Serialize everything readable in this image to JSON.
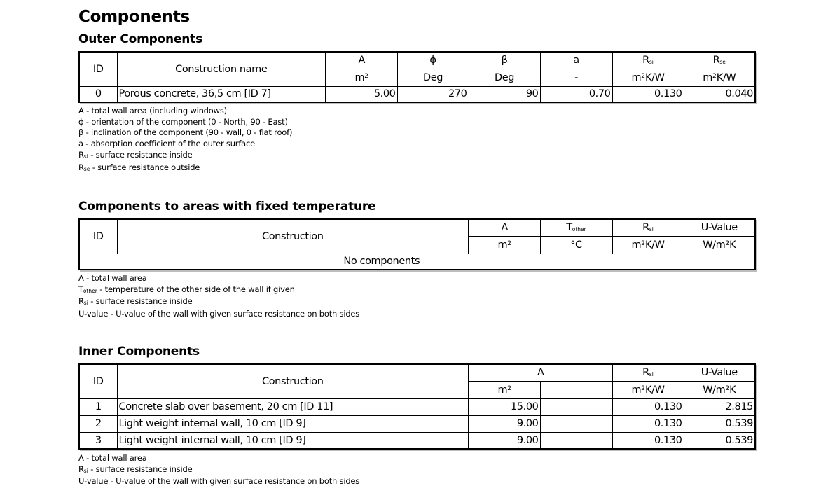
{
  "title": "Components",
  "outer": {
    "heading": "Outer Components",
    "headers": {
      "id": "ID",
      "name": "Construction name",
      "a_sym": "A",
      "a_unit_base": "m",
      "a_unit_sup": "2",
      "phi_sym": "ϕ",
      "phi_unit": "Deg",
      "beta_sym": "β",
      "beta_unit": "Deg",
      "abs_sym": "a",
      "abs_unit": "-",
      "rsi_base": "R",
      "rsi_sub": "si",
      "rsi_unit_pre": "m",
      "rsi_unit_sup": "2",
      "rsi_unit_post": "K/W",
      "rse_base": "R",
      "rse_sub": "se",
      "rse_unit_pre": "m",
      "rse_unit_sup": "2",
      "rse_unit_post": "K/W"
    },
    "rows": [
      {
        "id": "0",
        "name": "Porous concrete, 36,5 cm [ID 7]",
        "a": "5.00",
        "phi": "270",
        "beta": "90",
        "abs": "0.70",
        "rsi": "0.130",
        "rse": "0.040"
      }
    ],
    "notes": {
      "a": "A - total wall area (including windows)",
      "phi": "ϕ - orientation of the component (0 - North, 90 - East)",
      "beta": "β - inclination of the component (90 - wall, 0 - flat roof)",
      "abs": "a - absorption coefficient of the outer surface",
      "rsi_base": "R",
      "rsi_sub": "si",
      "rsi_text": " - surface resistance inside",
      "rse_base": "R",
      "rse_sub": "se",
      "rse_text": " - surface resistance outside"
    }
  },
  "fixed": {
    "heading": "Components to areas with fixed temperature",
    "headers": {
      "id": "ID",
      "name": "Construction",
      "a_sym": "A",
      "a_unit_base": "m",
      "a_unit_sup": "2",
      "t_base": "T",
      "t_sub": "other",
      "t_unit": "°C",
      "rsi_base": "R",
      "rsi_sub": "si",
      "rsi_unit_pre": "m",
      "rsi_unit_sup": "2",
      "rsi_unit_post": "K/W",
      "u_sym": "U-Value",
      "u_unit_pre": "W/m",
      "u_unit_sup": "2",
      "u_unit_post": "K"
    },
    "empty_message": "No components",
    "notes": {
      "a": "A - total wall area",
      "t_base": "T",
      "t_sub": "other",
      "t_text": " - temperature of the other side of the wall if given",
      "rsi_base": "R",
      "rsi_sub": "si",
      "rsi_text": " - surface resistance inside",
      "u": "U-value - U-value of the wall with given surface resistance on both sides"
    }
  },
  "inner": {
    "heading": "Inner Components",
    "headers": {
      "id": "ID",
      "name": "Construction",
      "a_sym": "A",
      "a_unit_base": "m",
      "a_unit_sup": "2",
      "rsi_base": "R",
      "rsi_sub": "si",
      "rsi_unit_pre": "m",
      "rsi_unit_sup": "2",
      "rsi_unit_post": "K/W",
      "u_sym": "U-Value",
      "u_unit_pre": "W/m",
      "u_unit_sup": "2",
      "u_unit_post": "K"
    },
    "rows": [
      {
        "id": "1",
        "name": "Concrete slab over basement, 20 cm [ID 11]",
        "a": "15.00",
        "rsi": "0.130",
        "u": "2.815"
      },
      {
        "id": "2",
        "name": "Light weight internal wall, 10 cm [ID 9]",
        "a": "9.00",
        "rsi": "0.130",
        "u": "0.539"
      },
      {
        "id": "3",
        "name": "Light weight internal wall, 10 cm [ID 9]",
        "a": "9.00",
        "rsi": "0.130",
        "u": "0.539"
      }
    ],
    "notes": {
      "a": "A - total wall area",
      "rsi_base": "R",
      "rsi_sub": "si",
      "rsi_text": " - surface resistance inside",
      "u": "U-value - U-value of the wall with given surface resistance on both sides"
    }
  }
}
